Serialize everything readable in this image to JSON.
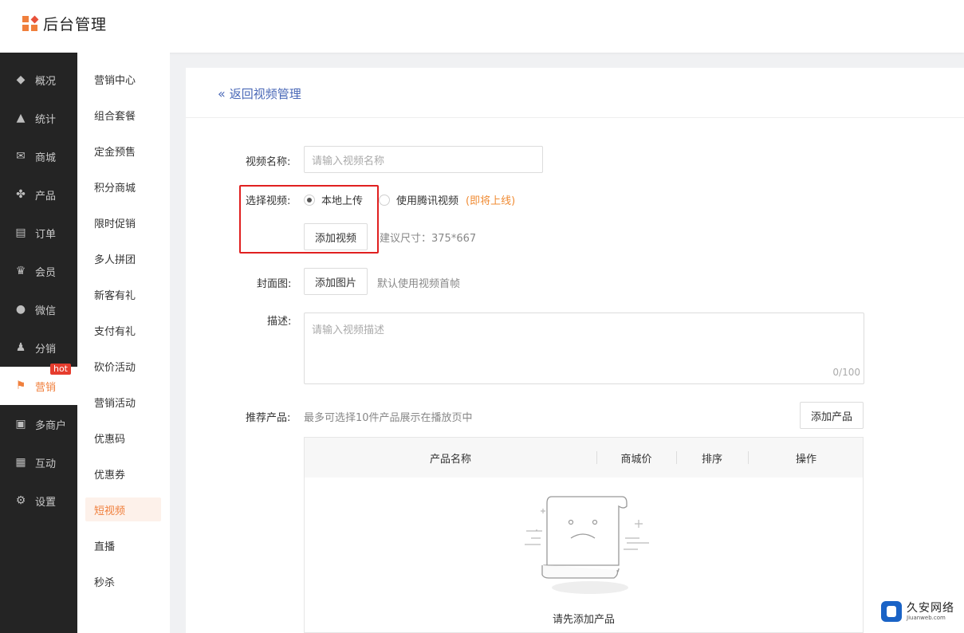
{
  "header": {
    "title": "后台管理"
  },
  "sidebar_primary": {
    "items": [
      {
        "label": "概况",
        "icon": "layers-icon"
      },
      {
        "label": "统计",
        "icon": "chart-icon"
      },
      {
        "label": "商城",
        "icon": "mail-icon"
      },
      {
        "label": "产品",
        "icon": "grid-icon"
      },
      {
        "label": "订单",
        "icon": "clipboard-icon"
      },
      {
        "label": "会员",
        "icon": "crown-icon"
      },
      {
        "label": "微信",
        "icon": "chat-icon"
      },
      {
        "label": "分销",
        "icon": "users-icon"
      },
      {
        "label": "营销",
        "icon": "flag-icon",
        "badge": "hot",
        "active": true
      },
      {
        "label": "多商户",
        "icon": "store-icon"
      },
      {
        "label": "互动",
        "icon": "apps-icon"
      },
      {
        "label": "设置",
        "icon": "gear-icon"
      }
    ]
  },
  "sidebar_secondary": {
    "items": [
      "营销中心",
      "组合套餐",
      "定金预售",
      "积分商城",
      "限时促销",
      "多人拼团",
      "新客有礼",
      "支付有礼",
      "砍价活动",
      "营销活动",
      "优惠码",
      "优惠券",
      "短视频",
      "直播",
      "秒杀"
    ],
    "active_index": 12
  },
  "main": {
    "back_label": "返回视频管理",
    "form": {
      "name_label": "视频名称:",
      "name_placeholder": "请输入视频名称",
      "video_label": "选择视频:",
      "radio_local": "本地上传",
      "radio_tencent": "使用腾讯视频",
      "coming_soon": "(即将上线)",
      "add_video_button": "添加视频",
      "size_hint": "建议尺寸：375*667",
      "cover_label": "封面图:",
      "add_image_button": "添加图片",
      "cover_hint": "默认使用视频首帧",
      "desc_label": "描述:",
      "desc_placeholder": "请输入视频描述",
      "desc_count": "0/100",
      "product_label": "推荐产品:",
      "product_hint": "最多可选择10件产品展示在播放页中",
      "add_product_button": "添加产品"
    },
    "table": {
      "columns": [
        "产品名称",
        "商城价",
        "排序",
        "操作"
      ],
      "empty_text": "请先添加产品"
    }
  },
  "watermark": {
    "main": "久安网络",
    "sub": "Jiuanweb.com"
  },
  "colors": {
    "accent": "#f07f3c",
    "link": "#4a68b7",
    "highlight_box": "#e02020",
    "sidebar_dark": "#242424",
    "hot_badge": "#e63d2e"
  }
}
